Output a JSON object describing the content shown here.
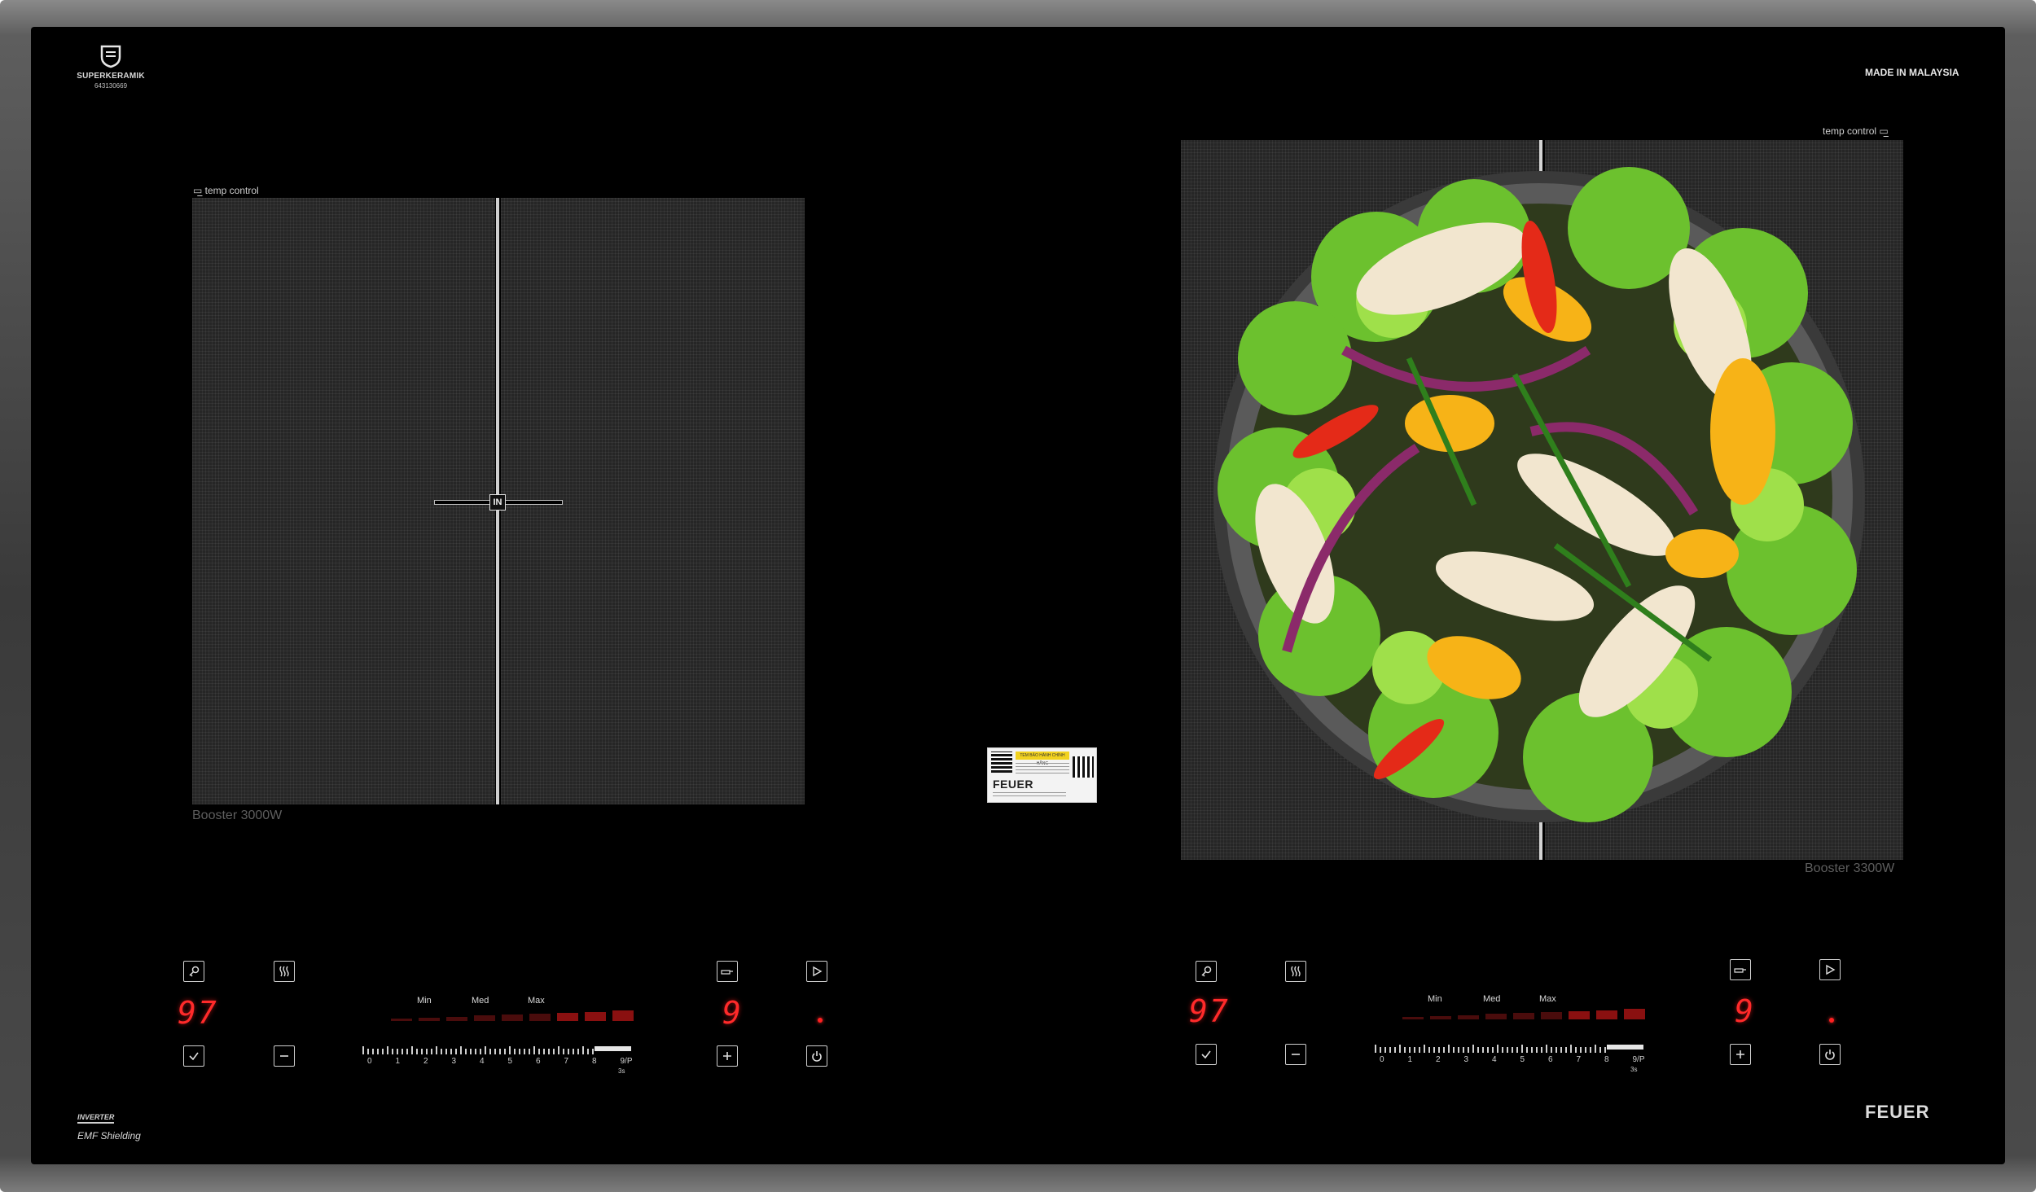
{
  "cooktop": {
    "certification": {
      "name": "SUPERKERAMIK",
      "code": "643130669"
    },
    "made_in": "MADE IN MALAYSIA",
    "brand": "FEUER",
    "inverter": "INVERTER",
    "emf_shielding": "EMF Shielding"
  },
  "zones": {
    "left": {
      "temp_control": "temp control",
      "booster": "Booster 3000W",
      "flex_badge": "IN"
    },
    "right": {
      "temp_control": "temp control",
      "booster": "Booster 3300W"
    }
  },
  "sticker": {
    "brand": "FEUER",
    "top_text": "TEM BẢO HÀNH CHÍNH HÃNG"
  },
  "controls": {
    "left": {
      "timer_display": "97",
      "power_display": "9",
      "level_labels": {
        "min": "Min",
        "med": "Med",
        "max": "Max"
      },
      "scale_numbers": [
        "0",
        "1",
        "2",
        "3",
        "4",
        "5",
        "6",
        "7",
        "8",
        "9/P"
      ],
      "scale_sub": "3s"
    },
    "right": {
      "timer_display": "97",
      "power_display": "9",
      "level_labels": {
        "min": "Min",
        "med": "Med",
        "max": "Max"
      },
      "scale_numbers": [
        "0",
        "1",
        "2",
        "3",
        "4",
        "5",
        "6",
        "7",
        "8",
        "9/P"
      ],
      "scale_sub": "3s"
    }
  },
  "icons": [
    "key-lock-icon",
    "keep-warm-icon",
    "confirm-check-icon",
    "minus-icon",
    "plus-icon",
    "pan-icon",
    "play-pause-icon",
    "power-icon"
  ],
  "colors": {
    "glass": "#000000",
    "display_red": "#ff2a2a",
    "zone_grey": "#262626"
  }
}
